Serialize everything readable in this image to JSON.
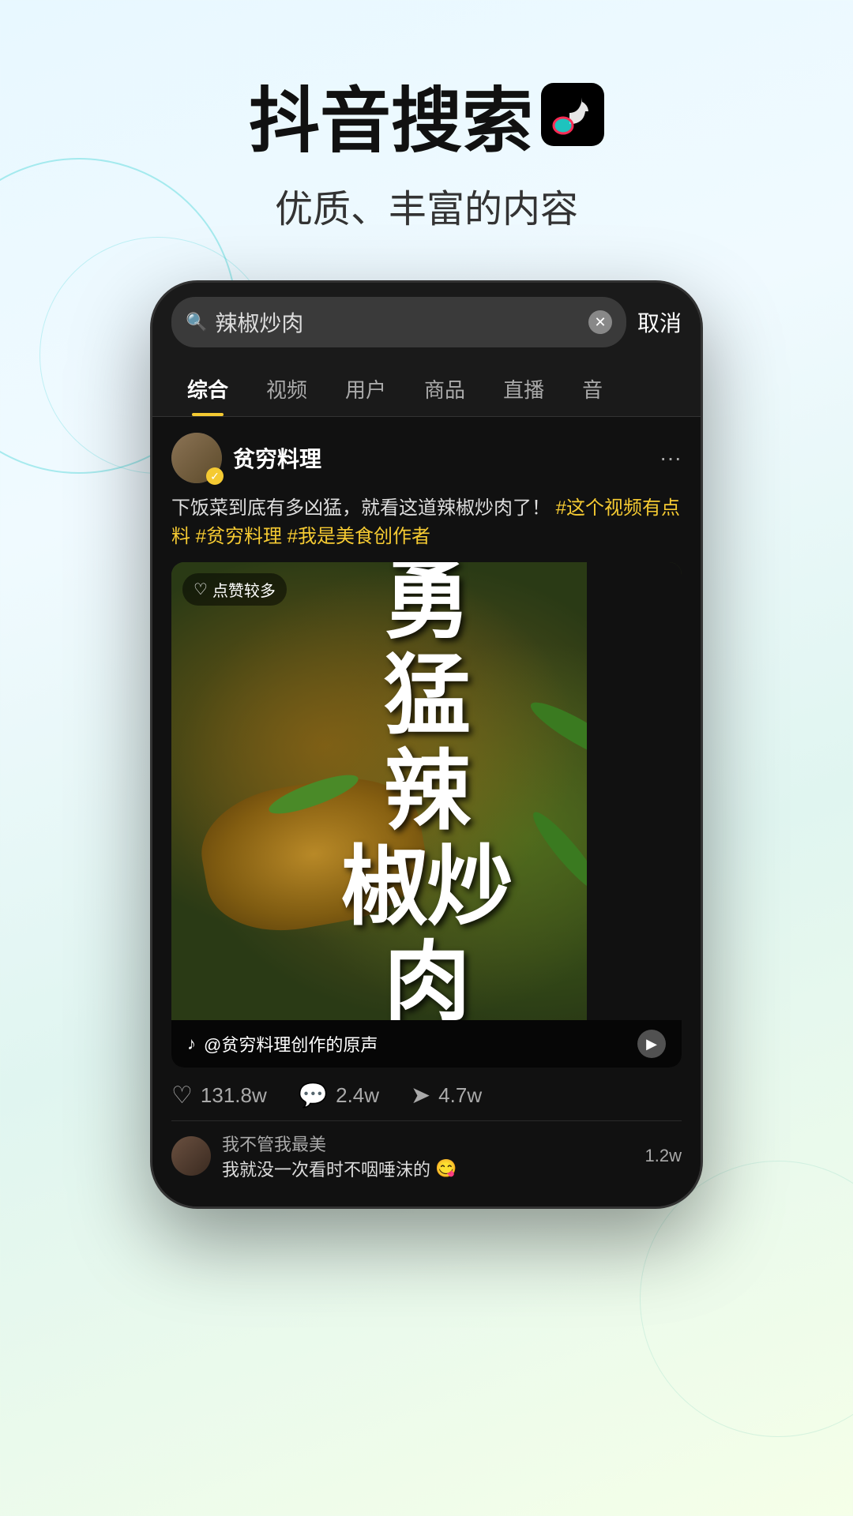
{
  "header": {
    "title": "抖音搜索",
    "subtitle": "优质、丰富的内容"
  },
  "search": {
    "query": "辣椒炒肉",
    "placeholder": "辣椒炒肉",
    "cancel_label": "取消"
  },
  "tabs": [
    {
      "id": "comprehensive",
      "label": "综合",
      "active": true
    },
    {
      "id": "video",
      "label": "视频",
      "active": false
    },
    {
      "id": "user",
      "label": "用户",
      "active": false
    },
    {
      "id": "product",
      "label": "商品",
      "active": false
    },
    {
      "id": "live",
      "label": "直播",
      "active": false
    },
    {
      "id": "music",
      "label": "音",
      "active": false
    }
  ],
  "post": {
    "username": "贫穷料理",
    "verified": true,
    "description": "下饭菜到底有多凶猛，就看这道辣椒炒肉了！",
    "hashtags": [
      "#这个视频有点料",
      "#贫穷料理",
      "#我是美食创作者"
    ],
    "likes_badge": "点赞较多",
    "video_overlay_text": "勇猛的辣椒炒肉",
    "audio_text": "@贫穷料理创作的原声",
    "more_btn_label": "···"
  },
  "engagement": {
    "likes": "131.8w",
    "comments": "2.4w",
    "shares": "4.7w"
  },
  "comments": [
    {
      "username": "我不管我最美",
      "text": "我就没一次看时不咽唾沫的",
      "emoji": "😋",
      "count": "1.2w"
    }
  ],
  "icons": {
    "search": "🔍",
    "clear": "✕",
    "more": "···",
    "heart": "♥",
    "comment": "💬",
    "share": "➤",
    "play": "▶",
    "music": "♪",
    "verified_check": "✓"
  }
}
